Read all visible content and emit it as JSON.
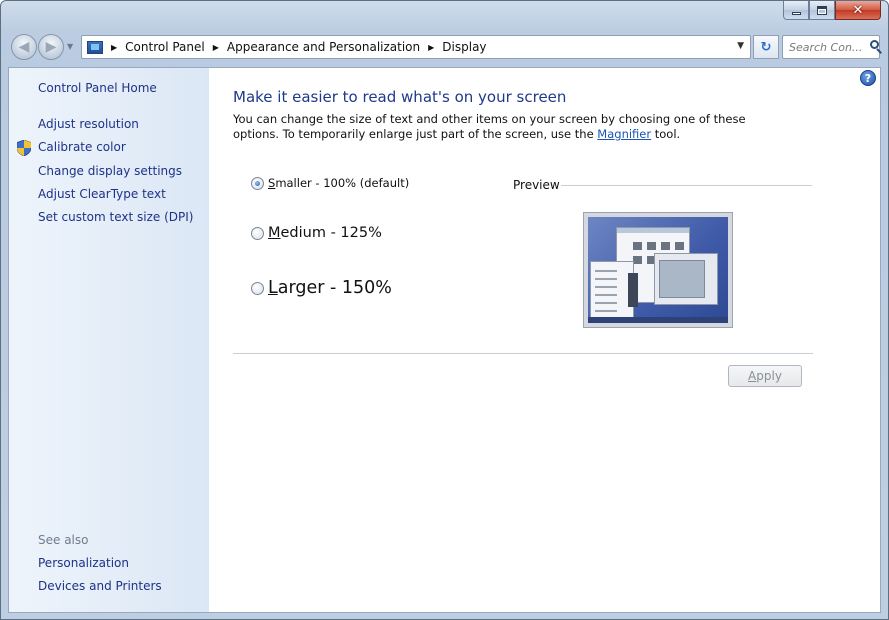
{
  "window": {
    "minimize_glyph": "minimize",
    "maximize_glyph": "maximize",
    "close_glyph": "✕"
  },
  "nav": {
    "back_glyph": "◀",
    "forward_glyph": "▶",
    "breadcrumbs": [
      "Control Panel",
      "Appearance and Personalization",
      "Display"
    ],
    "separator": "▶",
    "search_placeholder": "Search Con...",
    "refresh_glyph": "↻"
  },
  "sidebar": {
    "home": "Control Panel Home",
    "links": [
      "Adjust resolution",
      "Calibrate color",
      "Change display settings",
      "Adjust ClearType text",
      "Set custom text size (DPI)"
    ],
    "see_also_label": "See also",
    "see_also_links": [
      "Personalization",
      "Devices and Printers"
    ]
  },
  "main": {
    "help_glyph": "?",
    "title": "Make it easier to read what's on your screen",
    "desc_before": "You can change the size of text and other items on your screen by choosing one of these options. To temporarily enlarge just part of the screen, use the ",
    "desc_link": "Magnifier",
    "desc_after": " tool.",
    "options": [
      {
        "accel": "S",
        "rest": "maller - 100% (default)",
        "checked": true
      },
      {
        "accel": "M",
        "rest": "edium - 125%",
        "checked": false
      },
      {
        "accel": "L",
        "rest": "arger - 150%",
        "checked": false
      }
    ],
    "preview_label": "Preview",
    "apply_accel": "A",
    "apply_rest": "pply",
    "apply_enabled": false
  },
  "colors": {
    "link": "#1e3287",
    "title": "#1e3a8a",
    "sidebar_bg": "#dbe7f5"
  }
}
